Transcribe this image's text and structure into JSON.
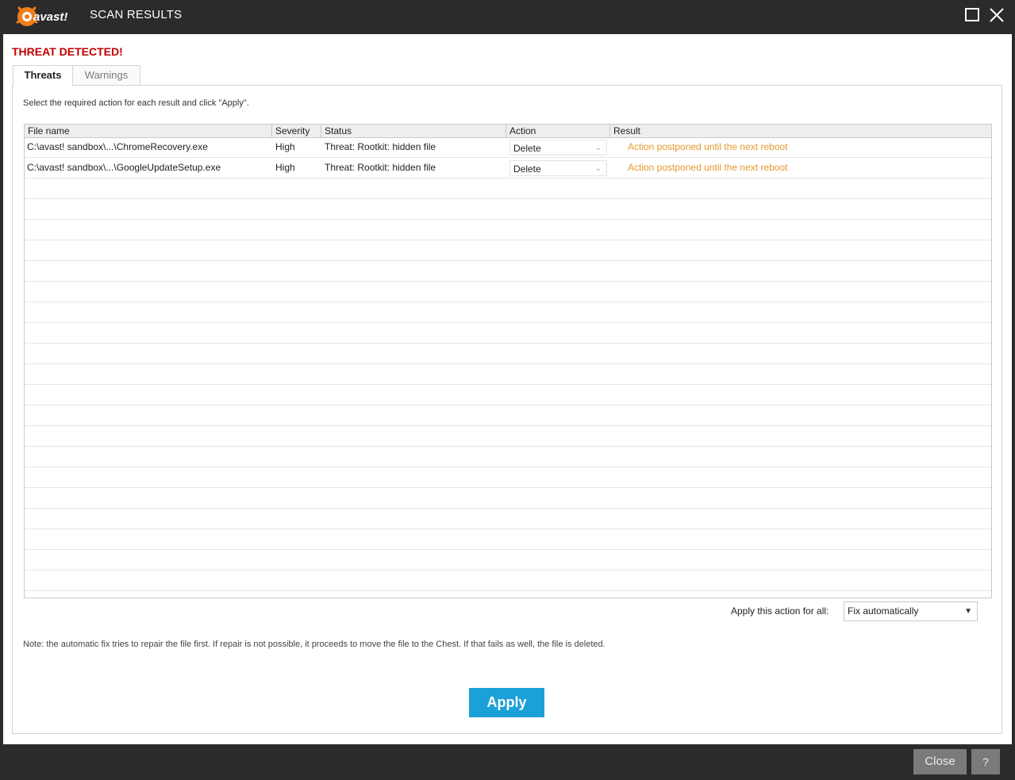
{
  "window": {
    "logo_text": "avast!",
    "title": "SCAN RESULTS"
  },
  "main": {
    "heading": "THREAT DETECTED!",
    "tabs": [
      {
        "label": "Threats",
        "active": true
      },
      {
        "label": "Warnings",
        "active": false
      }
    ],
    "instruction": "Select the required action for each result and click \"Apply\".",
    "table": {
      "columns": [
        "File name",
        "Severity",
        "Status",
        "Action",
        "Result"
      ],
      "rows": [
        {
          "file": "C:\\avast! sandbox\\...\\ChromeRecovery.exe",
          "severity": "High",
          "status": "Threat: Rootkit: hidden file",
          "action": "Delete",
          "result": "Action postponed until the next reboot"
        },
        {
          "file": "C:\\avast! sandbox\\...\\GoogleUpdateSetup.exe",
          "severity": "High",
          "status": "Threat: Rootkit: hidden file",
          "action": "Delete",
          "result": "Action postponed until the next reboot"
        }
      ]
    },
    "apply_all": {
      "label": "Apply this action for all:",
      "value": "Fix automatically"
    },
    "note": "Note: the automatic fix tries to repair the file first. If repair is not possible, it proceeds to move the file to the Chest. If that fails as well, the file is deleted.",
    "apply_button": "Apply"
  },
  "footer": {
    "close_label": "Close",
    "help_label": "?"
  },
  "colors": {
    "threat_red": "#c00000",
    "result_orange": "#e59a2f",
    "apply_blue": "#1ba1d8",
    "chrome_dark": "#2b2b2b",
    "logo_orange": "#f07e1b"
  }
}
